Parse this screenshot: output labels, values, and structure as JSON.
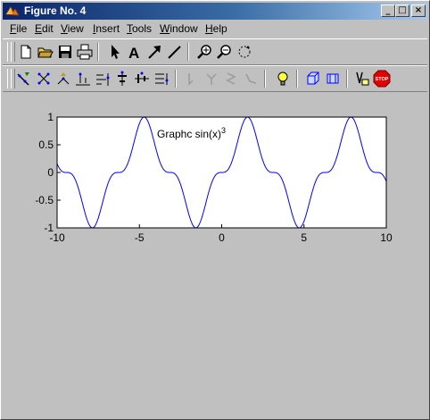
{
  "window": {
    "title": "Figure No. 4"
  },
  "window_buttons": {
    "minimize": "_",
    "maximize": "□",
    "close": "×"
  },
  "menu": [
    {
      "label": "File",
      "key": "F",
      "rest": "ile"
    },
    {
      "label": "Edit",
      "key": "E",
      "rest": "dit"
    },
    {
      "label": "View",
      "key": "V",
      "rest": "iew"
    },
    {
      "label": "Insert",
      "key": "I",
      "rest": "nsert"
    },
    {
      "label": "Tools",
      "key": "T",
      "rest": "ools"
    },
    {
      "label": "Window",
      "key": "W",
      "rest": "indow"
    },
    {
      "label": "Help",
      "key": "H",
      "rest": "elp"
    }
  ],
  "toolbar1": [
    "new-file-icon",
    "open-folder-icon",
    "save-icon",
    "print-icon",
    "arrow-select-icon",
    "text-insert-icon",
    "arrow-insert-icon",
    "line-insert-icon",
    "zoom-in-icon",
    "zoom-out-icon",
    "rotate-icon"
  ],
  "toolbar2": [
    "edit-point-icon",
    "scatter-point-icon",
    "move-point-icon",
    "align-icon",
    "distribute-icon",
    "align-center-icon",
    "align-middle-icon",
    "align-stack-icon",
    "disabled-tool-1-icon",
    "disabled-tool-2-icon",
    "disabled-tool-3-icon",
    "disabled-tool-4-icon",
    "lightbulb-icon",
    "cube-icon",
    "cube-view-icon",
    "data-tip-icon",
    "stop-icon"
  ],
  "stop_label": "STOP",
  "chart_data": {
    "type": "line",
    "title": "Graphc sin(x)",
    "title_superscript": "3",
    "function": "sin(x)^3",
    "xlim": [
      -10,
      10
    ],
    "ylim": [
      -1,
      1
    ],
    "x_ticks": [
      -10,
      -5,
      0,
      5,
      10
    ],
    "x_tick_labels": [
      "-10",
      "-5",
      "0",
      "5",
      "10"
    ],
    "y_ticks": [
      1,
      0.5,
      0,
      -0.5,
      -1
    ],
    "y_tick_labels": [
      "1",
      "0.5",
      "0",
      "-0.5",
      "-1"
    ],
    "grid": false,
    "series": [
      {
        "color": "#0000ff",
        "samples": 400
      }
    ]
  }
}
